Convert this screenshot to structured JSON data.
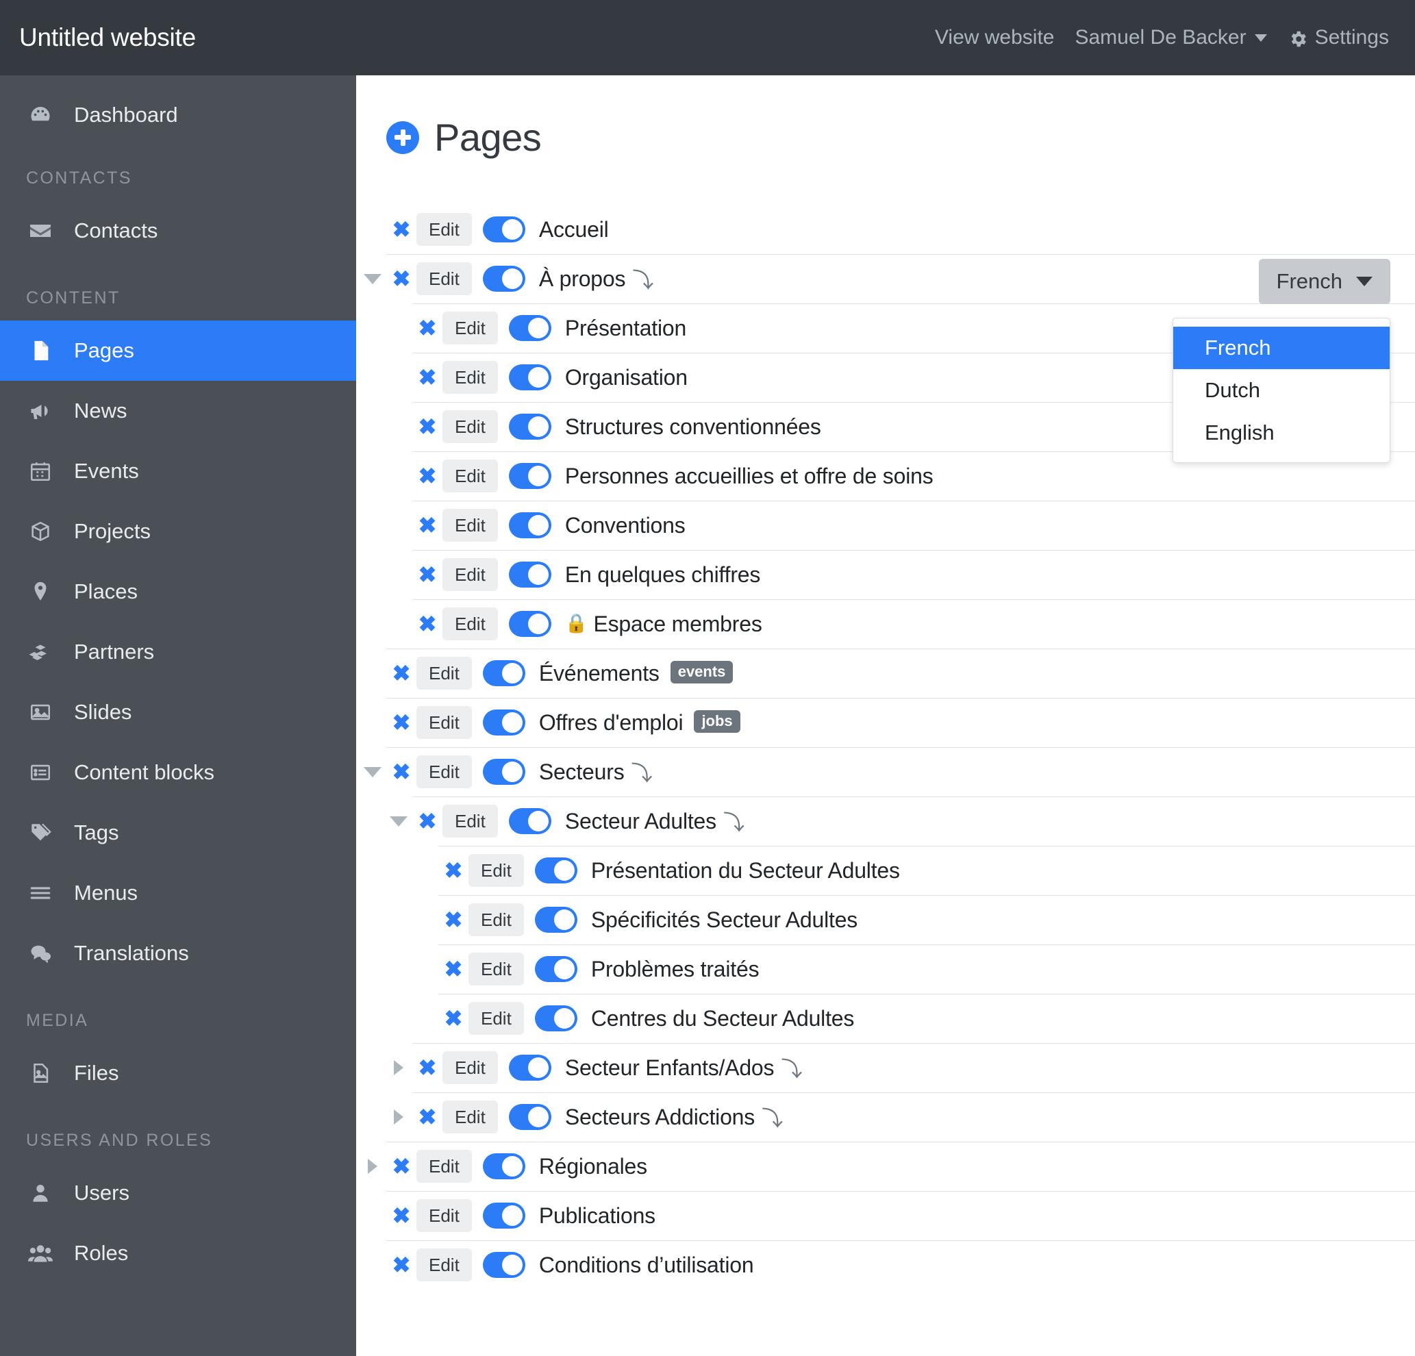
{
  "topbar": {
    "brand": "Untitled website",
    "view_website": "View website",
    "user_name": "Samuel De Backer",
    "settings": "Settings"
  },
  "sidebar": {
    "groups": [
      {
        "label": null,
        "items": [
          {
            "label": "Dashboard",
            "icon": "dashboard-icon",
            "active": false
          }
        ]
      },
      {
        "label": "CONTACTS",
        "items": [
          {
            "label": "Contacts",
            "icon": "envelope-icon",
            "active": false
          }
        ]
      },
      {
        "label": "CONTENT",
        "items": [
          {
            "label": "Pages",
            "icon": "page-icon",
            "active": true
          },
          {
            "label": "News",
            "icon": "megaphone-icon",
            "active": false
          },
          {
            "label": "Events",
            "icon": "calendar-icon",
            "active": false
          },
          {
            "label": "Projects",
            "icon": "box-icon",
            "active": false
          },
          {
            "label": "Places",
            "icon": "map-pin-icon",
            "active": false
          },
          {
            "label": "Partners",
            "icon": "blocks-icon",
            "active": false
          },
          {
            "label": "Slides",
            "icon": "image-icon",
            "active": false
          },
          {
            "label": "Content blocks",
            "icon": "list-panel-icon",
            "active": false
          },
          {
            "label": "Tags",
            "icon": "tag-icon",
            "active": false
          },
          {
            "label": "Menus",
            "icon": "hamburger-icon",
            "active": false
          },
          {
            "label": "Translations",
            "icon": "chat-bubbles-icon",
            "active": false
          }
        ]
      },
      {
        "label": "MEDIA",
        "items": [
          {
            "label": "Files",
            "icon": "file-image-icon",
            "active": false
          }
        ]
      },
      {
        "label": "USERS AND ROLES",
        "items": [
          {
            "label": "Users",
            "icon": "user-icon",
            "active": false
          },
          {
            "label": "Roles",
            "icon": "users-group-icon",
            "active": false
          }
        ]
      }
    ]
  },
  "main": {
    "title": "Pages",
    "add_label": "+",
    "language": {
      "selected": "French",
      "options": [
        {
          "label": "French",
          "selected": true
        },
        {
          "label": "Dutch",
          "selected": false
        },
        {
          "label": "English",
          "selected": false
        }
      ]
    },
    "edit_label": "Edit",
    "delete_label": "✖",
    "redirect_glyph": "⤵",
    "lock_glyph": "🔒",
    "rows": [
      {
        "level": 0,
        "twisty": "none",
        "label": "Accueil",
        "badge": null,
        "lock": false,
        "redirect": false,
        "toggle": true
      },
      {
        "level": 0,
        "twisty": "down",
        "label": "À propos",
        "badge": null,
        "lock": false,
        "redirect": true,
        "toggle": true
      },
      {
        "level": 1,
        "twisty": "none",
        "label": "Présentation",
        "badge": null,
        "lock": false,
        "redirect": false,
        "toggle": true
      },
      {
        "level": 1,
        "twisty": "none",
        "label": "Organisation",
        "badge": null,
        "lock": false,
        "redirect": false,
        "toggle": true
      },
      {
        "level": 1,
        "twisty": "none",
        "label": "Structures conventionnées",
        "badge": null,
        "lock": false,
        "redirect": false,
        "toggle": true
      },
      {
        "level": 1,
        "twisty": "none",
        "label": "Personnes accueillies et offre de soins",
        "badge": null,
        "lock": false,
        "redirect": false,
        "toggle": true
      },
      {
        "level": 1,
        "twisty": "none",
        "label": "Conventions",
        "badge": null,
        "lock": false,
        "redirect": false,
        "toggle": true
      },
      {
        "level": 1,
        "twisty": "none",
        "label": "En quelques chiffres",
        "badge": null,
        "lock": false,
        "redirect": false,
        "toggle": true
      },
      {
        "level": 1,
        "twisty": "none",
        "label": "Espace membres",
        "badge": null,
        "lock": true,
        "redirect": false,
        "toggle": true
      },
      {
        "level": 0,
        "twisty": "none",
        "label": "Événements",
        "badge": "events",
        "lock": false,
        "redirect": false,
        "toggle": true
      },
      {
        "level": 0,
        "twisty": "none",
        "label": "Offres d'emploi",
        "badge": "jobs",
        "lock": false,
        "redirect": false,
        "toggle": true
      },
      {
        "level": 0,
        "twisty": "down",
        "label": "Secteurs",
        "badge": null,
        "lock": false,
        "redirect": true,
        "toggle": true
      },
      {
        "level": 1,
        "twisty": "down",
        "label": "Secteur Adultes",
        "badge": null,
        "lock": false,
        "redirect": true,
        "toggle": true
      },
      {
        "level": 2,
        "twisty": "none",
        "label": "Présentation du Secteur Adultes",
        "badge": null,
        "lock": false,
        "redirect": false,
        "toggle": true
      },
      {
        "level": 2,
        "twisty": "none",
        "label": "Spécificités Secteur Adultes",
        "badge": null,
        "lock": false,
        "redirect": false,
        "toggle": true
      },
      {
        "level": 2,
        "twisty": "none",
        "label": "Problèmes traités",
        "badge": null,
        "lock": false,
        "redirect": false,
        "toggle": true
      },
      {
        "level": 2,
        "twisty": "none",
        "label": "Centres du Secteur Adultes",
        "badge": null,
        "lock": false,
        "redirect": false,
        "toggle": true
      },
      {
        "level": 1,
        "twisty": "right",
        "label": "Secteur Enfants/Ados",
        "badge": null,
        "lock": false,
        "redirect": true,
        "toggle": true
      },
      {
        "level": 1,
        "twisty": "right",
        "label": "Secteurs Addictions",
        "badge": null,
        "lock": false,
        "redirect": true,
        "toggle": true
      },
      {
        "level": 0,
        "twisty": "right",
        "label": "Régionales",
        "badge": null,
        "lock": false,
        "redirect": false,
        "toggle": true
      },
      {
        "level": 0,
        "twisty": "none",
        "label": "Publications",
        "badge": null,
        "lock": false,
        "redirect": false,
        "toggle": true
      },
      {
        "level": 0,
        "twisty": "none",
        "label": "Conditions d’utilisation",
        "badge": null,
        "lock": false,
        "redirect": false,
        "toggle": true
      }
    ]
  },
  "colors": {
    "accent": "#2b7cf6",
    "topbar_bg": "#343a40",
    "sidebar_bg": "#4a5056",
    "badge_bg": "#6c757d",
    "edit_btn_bg": "#eceef0",
    "lang_btn_bg": "#c7cbcf"
  }
}
